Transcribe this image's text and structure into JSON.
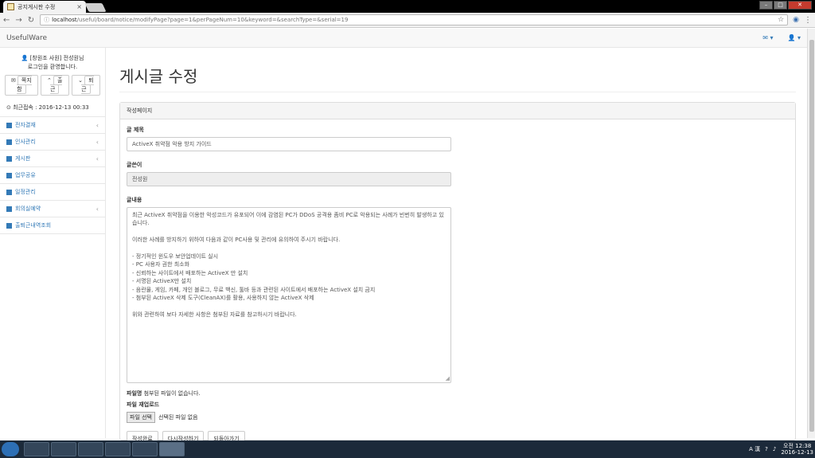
{
  "browser": {
    "tab_title": "공지게시판 수정",
    "tab_close": "×",
    "url_host": "localhost",
    "url_path": "/useful/board/notice/modifyPage?page=1&perPageNum=10&keyword=&searchType=&serial=19",
    "win_min": "–",
    "win_max": "□",
    "win_close": "✕"
  },
  "navbar": {
    "brand": "UsefulWare",
    "mail_icon": "✉ ▾",
    "user_icon": "👤 ▾"
  },
  "sidebar": {
    "user_line1": "[창원조 사원] 전성원님",
    "user_line2": "로그인을 환영합니다.",
    "buttons": [
      "쪽지함",
      "출근",
      "퇴근"
    ],
    "last_login_label": "최근접속 : 2016-12-13 00:33",
    "items": [
      {
        "label": "전자결재",
        "has_sub": true
      },
      {
        "label": "인사관리",
        "has_sub": true
      },
      {
        "label": "게시판",
        "has_sub": true
      },
      {
        "label": "업무공유",
        "has_sub": false
      },
      {
        "label": "일정관리",
        "has_sub": false
      },
      {
        "label": "회의실예약",
        "has_sub": true
      },
      {
        "label": "출퇴근내역조회",
        "has_sub": false
      }
    ],
    "chevron": "‹"
  },
  "main": {
    "title": "게시글 수정",
    "panel_heading": "작성페이지",
    "title_label": "글 제목",
    "title_value": "ActiveX 취약점 악용 방지 가이드",
    "writer_label": "글쓴이",
    "writer_value": "전성원",
    "content_label": "글내용",
    "content_value": "최근 ActiveX 취약점을 이용한 악성코드가 유포되어 이에 감염된 PC가 DDoS 공격용 좀비 PC로 악용되는 사례가 빈번히 발생하고 있습니다.\n\n이러한 사례를 방지하기 위하여 다음과 같이 PC사용 및 관리에 유의하여 주시기 바랍니다.\n\n- 정기적인 윈도우 보안업데이트 실시\n- PC 사용자 권한 최소화\n- 신뢰하는 사이트에서 배포하는 ActiveX 만 설치\n- 서명된 ActiveX만 설치\n- 음란물, 게임, 카페, 개인 블로그, 무료 백신, 툴바 등과 관련된 사이트에서 배포하는 ActiveX 설치 금지\n- 첨부된 ActiveX 삭제 도구(CleanAX)를 활용, 사용하지 않는 ActiveX 삭제\n\n위와 관련하여 보다 자세한 사항은 첨부된 자료를 참고하시기 바랍니다.",
    "file_name_label": "파일명",
    "file_name_value": "첨부된 파일이 없습니다.",
    "file_upload_label": "파일 재업로드",
    "file_button": "파일 선택",
    "file_none": "선택된 파일 없음",
    "actions": [
      "작성완료",
      "다시작성하기",
      "되돌아가기"
    ]
  },
  "taskbar": {
    "ime": "A 漢",
    "time": "오전 12:38",
    "date": "2016-12-13"
  }
}
